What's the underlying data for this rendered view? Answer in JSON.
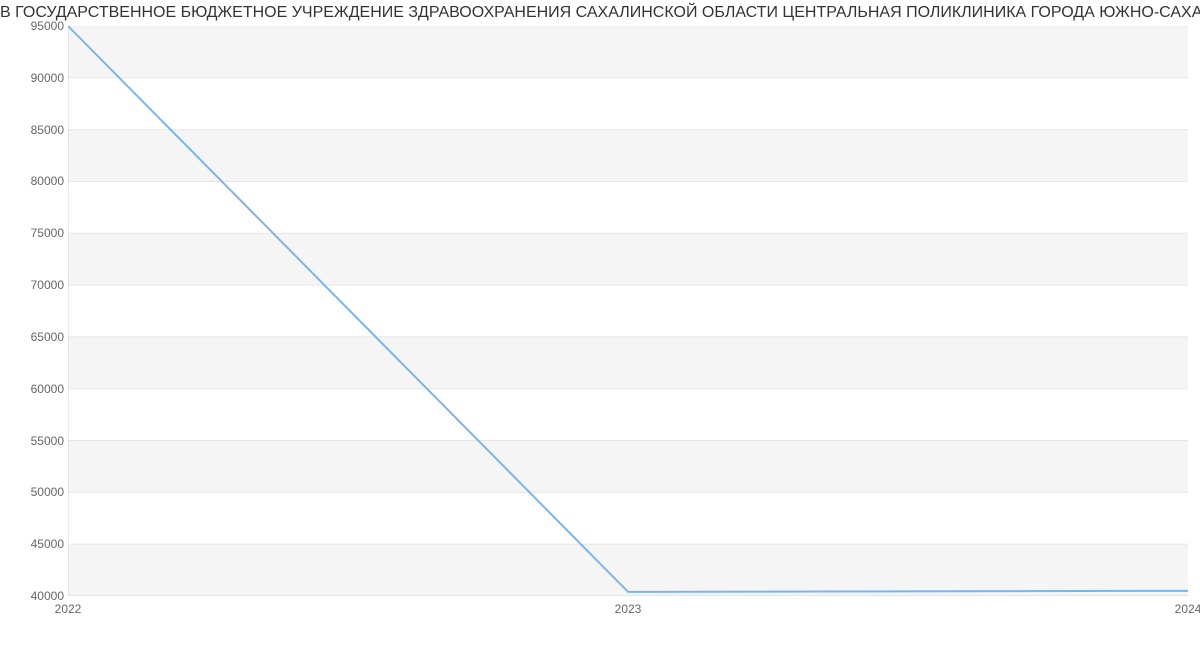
{
  "chart_data": {
    "type": "line",
    "title": "В ГОСУДАРСТВЕННОЕ БЮДЖЕТНОЕ УЧРЕЖДЕНИЕ ЗДРАВООХРАНЕНИЯ САХАЛИНСКОЙ ОБЛАСТИ ЦЕНТРАЛЬНАЯ ПОЛИКЛИНИКА ГОРОДА ЮЖНО-САХАЛИНСКА | Данные m",
    "categories": [
      "2022",
      "2023",
      "2024"
    ],
    "values": [
      95000,
      40400,
      40500
    ],
    "y_ticks": [
      "40000",
      "45000",
      "50000",
      "55000",
      "60000",
      "65000",
      "70000",
      "75000",
      "80000",
      "85000",
      "90000",
      "95000"
    ],
    "xlabel": "",
    "ylabel": "",
    "ylim": [
      40000,
      95000
    ],
    "xlim": [
      2022,
      2024
    ]
  }
}
